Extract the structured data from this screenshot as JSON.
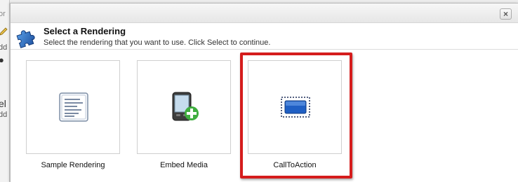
{
  "background": {
    "fragments": [
      "or",
      "dd",
      "el",
      "dd"
    ]
  },
  "dialog": {
    "close_label": "×",
    "header": {
      "title": "Select a Rendering",
      "subtitle": "Select the rendering that you want to use. Click Select to continue.",
      "icon": "puzzle-icon"
    },
    "renderings": [
      {
        "label": "Sample Rendering",
        "icon": "document-icon"
      },
      {
        "label": "Embed Media",
        "icon": "pda-add-icon"
      },
      {
        "label": "CallToAction",
        "icon": "selected-box-icon",
        "highlighted": true
      }
    ]
  },
  "colors": {
    "highlight": "#d51c1c",
    "accent_blue": "#1f5fc4"
  }
}
